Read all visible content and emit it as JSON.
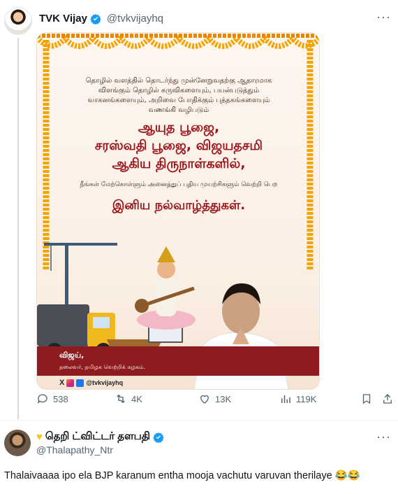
{
  "tweet": {
    "name": "TVK Vijay",
    "handle": "@tvkvijayhq",
    "more_label": "···",
    "stats": {
      "replies": "538",
      "retweets": "4K",
      "likes": "13K",
      "views": "119K"
    }
  },
  "poster": {
    "intro_lines": [
      "தொழில் வளத்தில் தொடர்ந்து முன்னேறுவதற்கு ஆதாரமாக",
      "விளங்கும் தொழில் கருவிகளையும், பயன்படுத்தும்",
      "வாகனங்களையும், அறிவை போதிக்கும் புத்தகங்களையும்",
      "வணங்கி வழிபடும்"
    ],
    "headline_lines": [
      "ஆயுத பூஜை,",
      "சரஸ்வதி பூஜை, விஜயதசமி",
      "ஆகிய திருநாள்களில்,"
    ],
    "mid_line": "நீங்கள் மேற்கொள்ளும் அனைத்துப் புதிய முயற்சிகளும் வெற்றி பெற",
    "greeting": "இனிய நல்வாழ்த்துகள்.",
    "signature_name": "விஜய்,",
    "signature_title": "தலைவர், தமிழக வெற்றிக் கழகம்.",
    "social_handle": "@tvkvijayhq"
  },
  "reply": {
    "name": "தெறி ட்விட்டர் தளபதி",
    "handle": "@Thalapathy_Ntr",
    "more_label": "···",
    "text": "Thalaivaaaa ipo ela BJP karanum entha mooja vachutu varuvan therilaye 😂😂"
  },
  "colors": {
    "verified": "#1d9bf0",
    "maroon": "#8d1b20",
    "headline_red": "#9b1218",
    "marigold": "#f5a300"
  }
}
